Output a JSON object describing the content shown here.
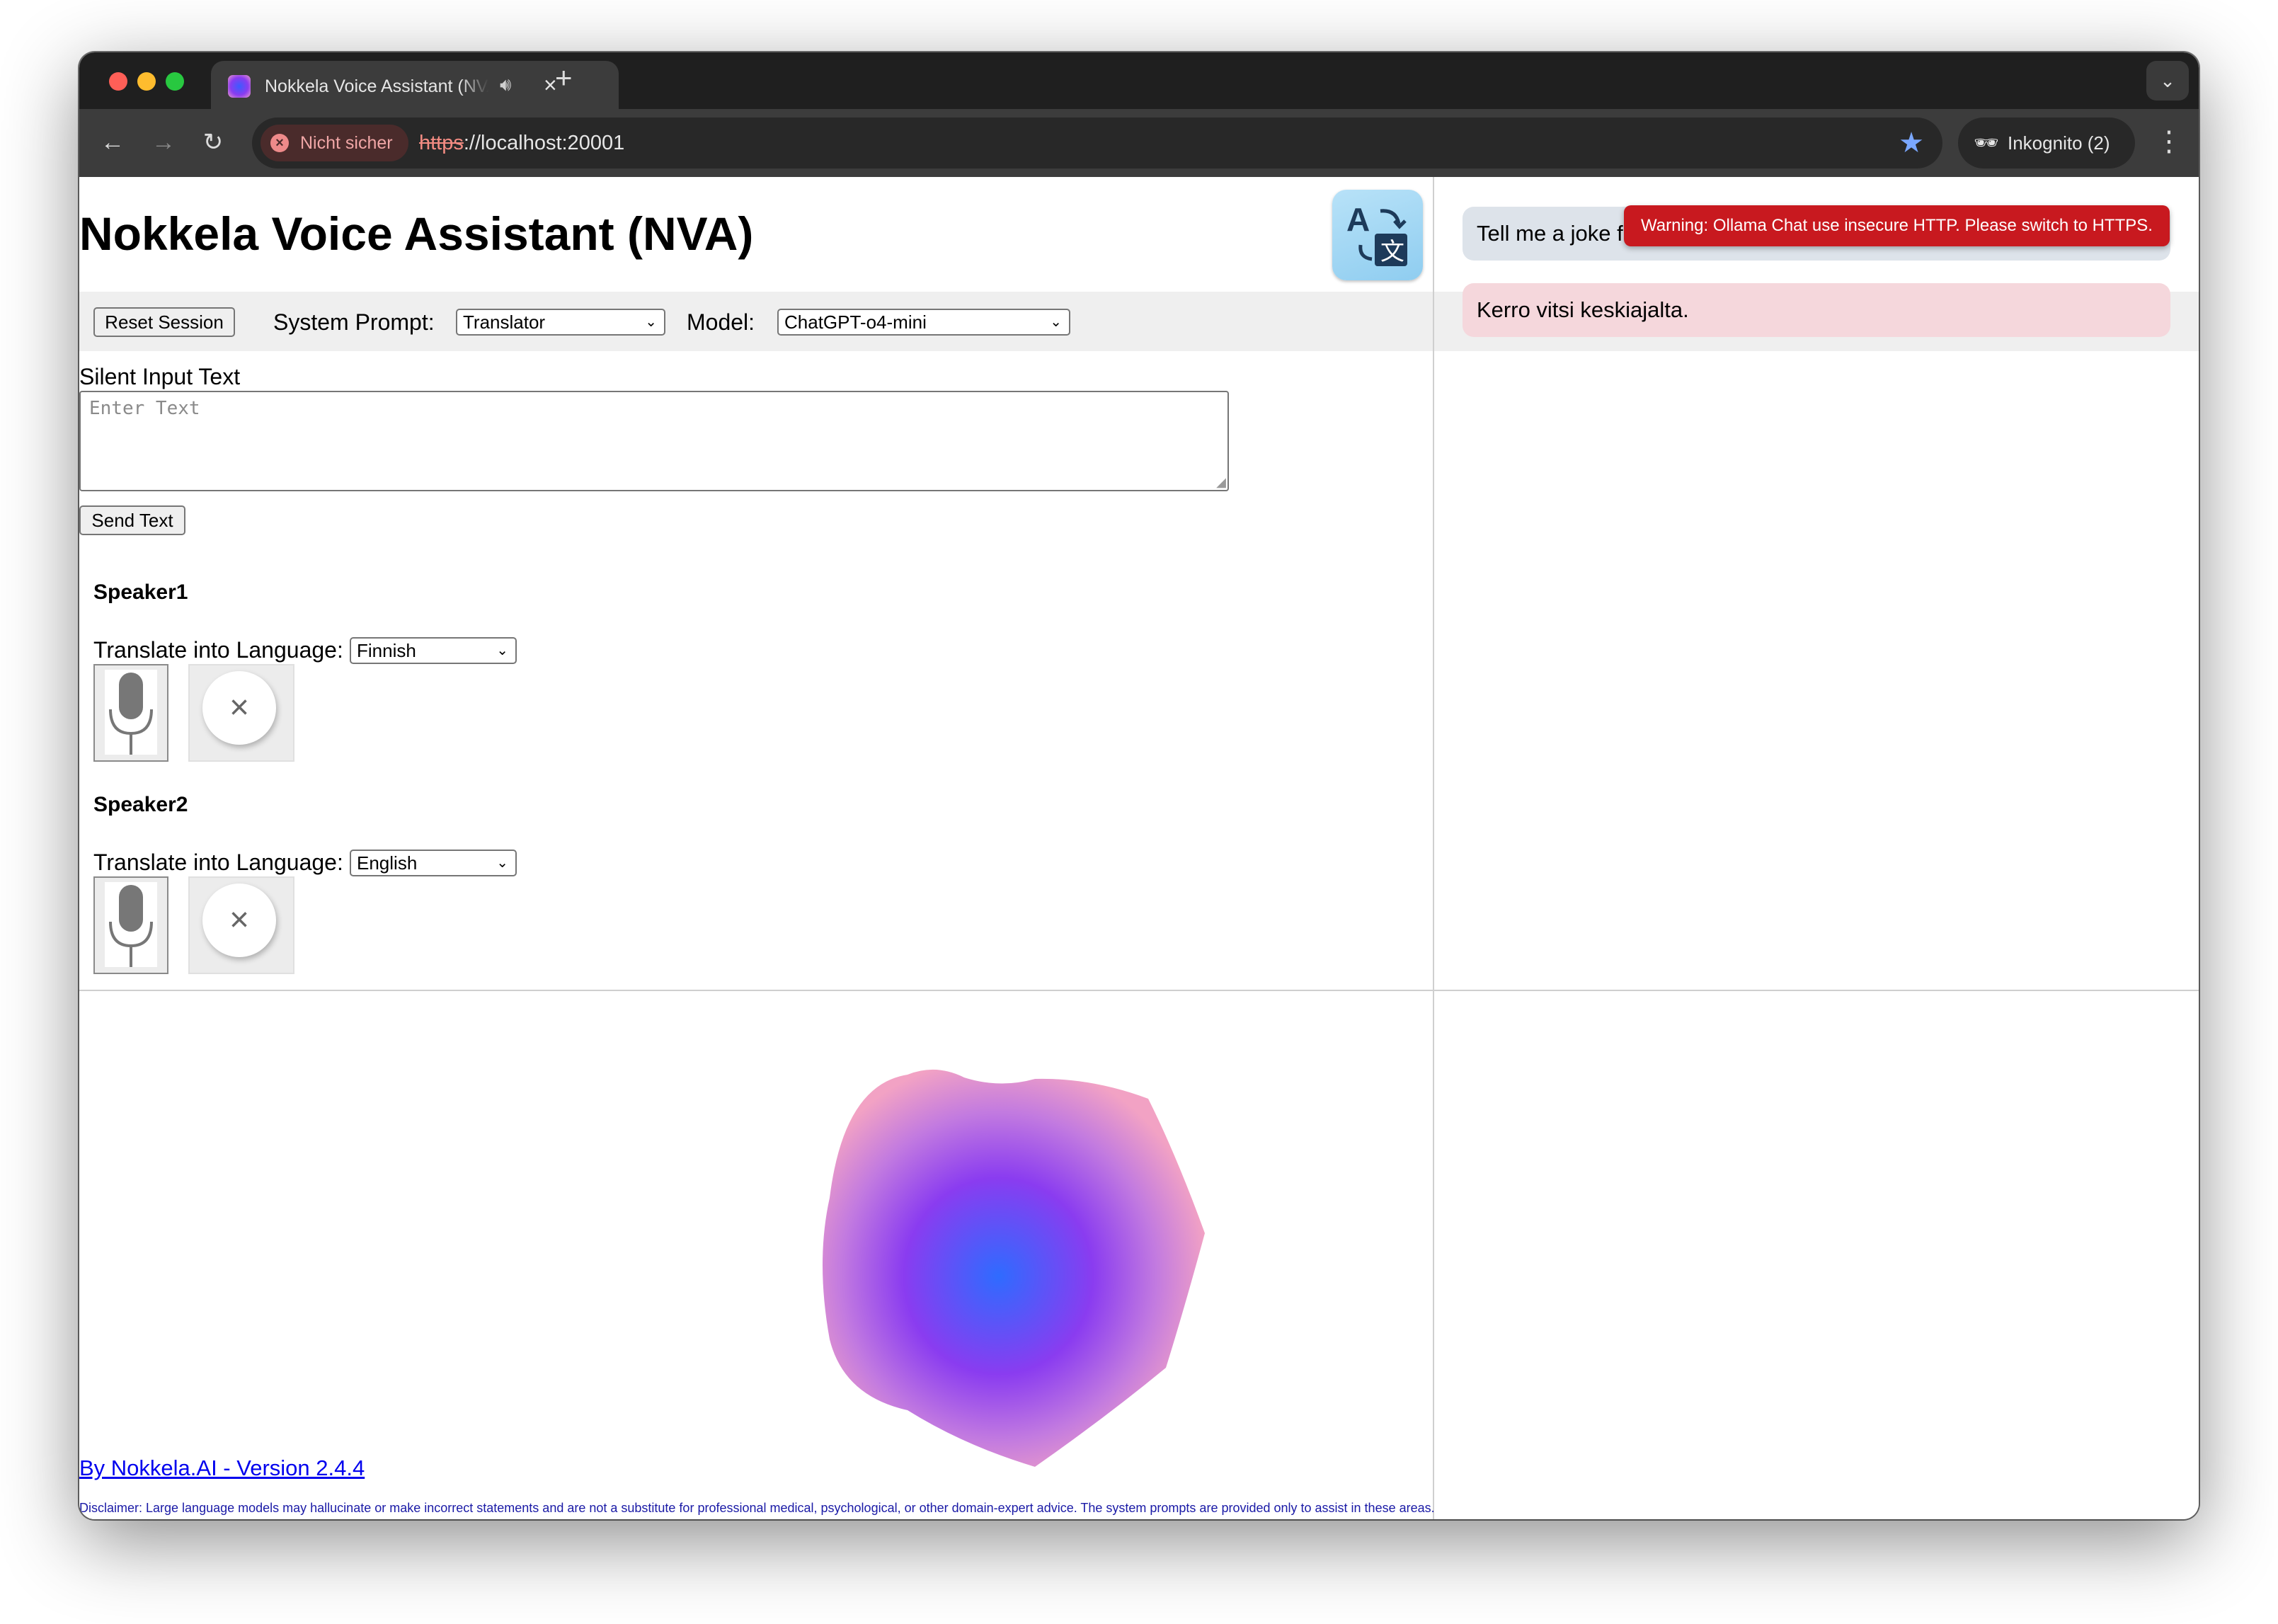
{
  "browser": {
    "tab_title": "Nokkela Voice Assistant (NVA)",
    "tab_audio_icon": "speaker-icon",
    "tab_close": "×",
    "new_tab": "+",
    "security_chip": "Nicht sicher",
    "url_scheme": "https",
    "url_rest": "://localhost:20001",
    "incognito_label": "Inkognito (2)",
    "colors": {
      "tabstrip": "#1f1f1f",
      "toolbar": "#3c3c3c",
      "bookmark_star": "#7aa7ff",
      "insecure": "#f28b82"
    }
  },
  "app": {
    "title": "Nokkela Voice Assistant (NVA)",
    "logo_icon": "translate-icon",
    "reset_label": "Reset Session",
    "system_prompt_label": "System Prompt:",
    "system_prompt_value": "Translator",
    "model_label": "Model:",
    "model_value": "ChatGPT-o4-mini",
    "silent_input_label": "Silent Input Text",
    "silent_input_placeholder": "Enter Text",
    "send_label": "Send Text",
    "translate_label": "Translate into Language:",
    "speakers": [
      {
        "name": "Speaker1",
        "language": "Finnish"
      },
      {
        "name": "Speaker2",
        "language": "English"
      }
    ],
    "footer_link": "By Nokkela.AI - Version 2.4.4",
    "disclaimer": "Disclaimer: Large language models may hallucinate or make incorrect statements and are not a substitute for professional medical, psychological, or other domain-expert advice. The system prompts are provided only to assist in these areas."
  },
  "chat": {
    "messages": [
      {
        "role": "user",
        "text": "Tell me a joke from the Middle Ages."
      },
      {
        "role": "assistant",
        "text": "Kerro vitsi keskiajalta."
      }
    ],
    "warning": "Warning: Ollama Chat use insecure HTTP. Please switch to HTTPS.",
    "colors": {
      "user_bubble": "#dde3ea",
      "assistant_bubble": "#f5d7dc",
      "warning": "#c8191f"
    }
  },
  "visualizer": {
    "colors": [
      "#2f6bff",
      "#8a3cf0",
      "#f2a2c4"
    ]
  }
}
